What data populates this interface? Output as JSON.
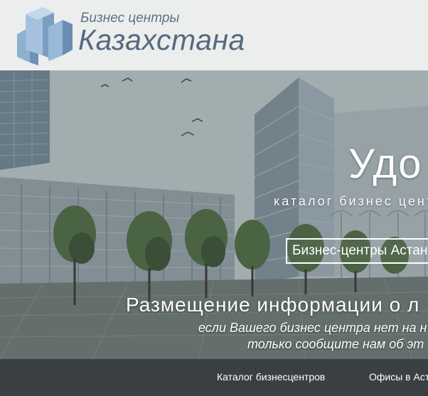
{
  "logo": {
    "subtitle": "Бизнес центры",
    "title": "Казахстана",
    "icon": "buildings-logo-icon",
    "color": "#556a80"
  },
  "hero": {
    "title": "Удо",
    "subtitle": "каталог бизнес цент",
    "button_label": "Бизнес-центры Астан",
    "heading": "Размещение информации о л",
    "note_line1": "если Вашего бизнес центра нет на н",
    "note_line2": "только сообщите нам об эт"
  },
  "nav": {
    "items": [
      {
        "label": "Каталог бизнесцентров"
      },
      {
        "label": "Офисы в Аст"
      }
    ],
    "background": "#3a3f44"
  }
}
